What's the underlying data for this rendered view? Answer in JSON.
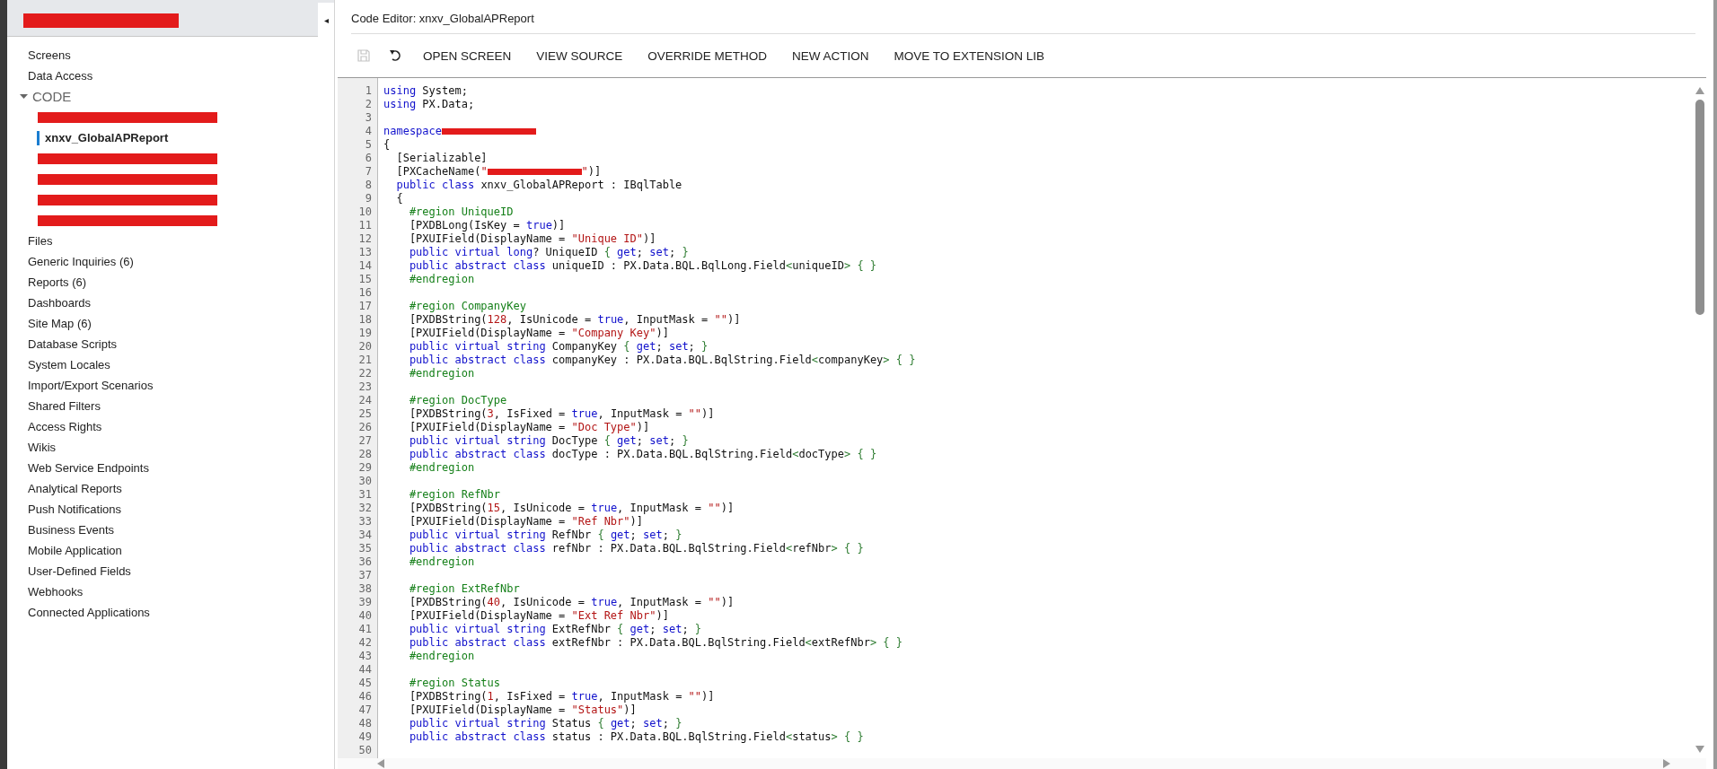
{
  "sidebar": {
    "header": {
      "redacted": true
    },
    "collapse_button": "◂",
    "items": [
      {
        "label": "Screens"
      },
      {
        "label": "Data Access"
      },
      {
        "label": "CODE",
        "expanded": true,
        "children": [
          {
            "redacted": true,
            "selected": false
          },
          {
            "label": "xnxv_GlobalAPReport",
            "selected": true
          },
          {
            "redacted": true,
            "selected": false
          },
          {
            "redacted": true,
            "selected": false
          },
          {
            "redacted": true,
            "selected": false
          },
          {
            "redacted": true,
            "selected": false
          }
        ]
      },
      {
        "label": "Files"
      },
      {
        "label": "Generic Inquiries (6)"
      },
      {
        "label": "Reports (6)"
      },
      {
        "label": "Dashboards"
      },
      {
        "label": "Site Map (6)"
      },
      {
        "label": "Database Scripts"
      },
      {
        "label": "System Locales"
      },
      {
        "label": "Import/Export Scenarios"
      },
      {
        "label": "Shared Filters"
      },
      {
        "label": "Access Rights"
      },
      {
        "label": "Wikis"
      },
      {
        "label": "Web Service Endpoints"
      },
      {
        "label": "Analytical Reports"
      },
      {
        "label": "Push Notifications"
      },
      {
        "label": "Business Events"
      },
      {
        "label": "Mobile Application"
      },
      {
        "label": "User-Defined Fields"
      },
      {
        "label": "Webhooks"
      },
      {
        "label": "Connected Applications"
      }
    ]
  },
  "editor": {
    "title": "Code Editor: xnxv_GlobalAPReport",
    "toolbar": [
      {
        "kind": "save",
        "disabled": true
      },
      {
        "kind": "undo",
        "disabled": false
      },
      {
        "kind": "text",
        "label": "OPEN SCREEN"
      },
      {
        "kind": "text",
        "label": "VIEW SOURCE"
      },
      {
        "kind": "text",
        "label": "OVERRIDE METHOD"
      },
      {
        "kind": "text",
        "label": "NEW ACTION"
      },
      {
        "kind": "text",
        "label": "MOVE TO EXTENSION LIB"
      }
    ],
    "lines": [
      {
        "number": "1",
        "tokens": [
          {
            "kind": "kw",
            "text": "using"
          },
          {
            "kind": "plain",
            "text": " System;"
          }
        ]
      },
      {
        "number": "2",
        "tokens": [
          {
            "kind": "kw",
            "text": "using"
          },
          {
            "kind": "plain",
            "text": " PX.Data;"
          }
        ]
      },
      {
        "number": "3"
      },
      {
        "number": "4",
        "tokens": [
          {
            "kind": "kw",
            "text": "namespace"
          },
          {
            "kind": "redaction"
          }
        ]
      },
      {
        "number": "5",
        "tokens": [
          {
            "kind": "plain",
            "text": "{"
          }
        ]
      },
      {
        "number": "6",
        "tokens": [
          {
            "kind": "plain",
            "text": "  [Serializable]"
          }
        ]
      },
      {
        "number": "7",
        "tokens": [
          {
            "kind": "plain",
            "text": "  [PXCacheName("
          },
          {
            "kind": "str",
            "text": "\""
          },
          {
            "kind": "redaction"
          },
          {
            "kind": "str",
            "text": "\""
          },
          {
            "kind": "plain",
            "text": ")]"
          }
        ]
      },
      {
        "number": "8",
        "tokens": [
          {
            "kind": "kw",
            "text": "  public class"
          },
          {
            "kind": "plain",
            "text": " xnxv_GlobalAPReport : IBqlTable"
          }
        ]
      },
      {
        "number": "9",
        "tokens": [
          {
            "kind": "plain",
            "text": "  {"
          }
        ]
      },
      {
        "number": "10",
        "tokens": [
          {
            "kind": "dir",
            "text": "    #region UniqueID"
          }
        ]
      },
      {
        "number": "11",
        "tokens": [
          {
            "kind": "plain",
            "text": "    [PXDBLong(IsKey = "
          },
          {
            "kind": "kw",
            "text": "true"
          },
          {
            "kind": "plain",
            "text": ")]"
          }
        ]
      },
      {
        "number": "12",
        "tokens": [
          {
            "kind": "plain",
            "text": "    [PXUIField(DisplayName = "
          },
          {
            "kind": "str",
            "text": "\"Unique ID\""
          },
          {
            "kind": "plain",
            "text": ")]"
          }
        ]
      },
      {
        "number": "13",
        "tokens": [
          {
            "kind": "kw",
            "text": "    public virtual long"
          },
          {
            "kind": "plain",
            "text": "? UniqueID "
          },
          {
            "kind": "punct",
            "text": "{"
          },
          {
            "kind": "kw",
            "text": " get"
          },
          {
            "kind": "plain",
            "text": ";"
          },
          {
            "kind": "kw",
            "text": " set"
          },
          {
            "kind": "plain",
            "text": ";"
          },
          {
            "kind": "punct",
            "text": " }"
          }
        ]
      },
      {
        "number": "14",
        "tokens": [
          {
            "kind": "kw",
            "text": "    public abstract class"
          },
          {
            "kind": "plain",
            "text": " uniqueID : PX.Data.BQL.BqlLong.Field"
          },
          {
            "kind": "punct",
            "text": "<"
          },
          {
            "kind": "plain",
            "text": "uniqueID"
          },
          {
            "kind": "punct",
            "text": "> { }"
          }
        ]
      },
      {
        "number": "15",
        "tokens": [
          {
            "kind": "dir",
            "text": "    #endregion"
          }
        ]
      },
      {
        "number": "16"
      },
      {
        "number": "17",
        "tokens": [
          {
            "kind": "dir",
            "text": "    #region CompanyKey"
          }
        ]
      },
      {
        "number": "18",
        "tokens": [
          {
            "kind": "plain",
            "text": "    [PXDBString("
          },
          {
            "kind": "num",
            "text": "128"
          },
          {
            "kind": "plain",
            "text": ", IsUnicode = "
          },
          {
            "kind": "kw",
            "text": "true"
          },
          {
            "kind": "plain",
            "text": ", InputMask = "
          },
          {
            "kind": "str",
            "text": "\"\""
          },
          {
            "kind": "plain",
            "text": ")]"
          }
        ]
      },
      {
        "number": "19",
        "tokens": [
          {
            "kind": "plain",
            "text": "    [PXUIField(DisplayName = "
          },
          {
            "kind": "str",
            "text": "\"Company Key\""
          },
          {
            "kind": "plain",
            "text": ")]"
          }
        ]
      },
      {
        "number": "20",
        "tokens": [
          {
            "kind": "kw",
            "text": "    public virtual string"
          },
          {
            "kind": "plain",
            "text": " CompanyKey "
          },
          {
            "kind": "punct",
            "text": "{"
          },
          {
            "kind": "kw",
            "text": " get"
          },
          {
            "kind": "plain",
            "text": ";"
          },
          {
            "kind": "kw",
            "text": " set"
          },
          {
            "kind": "plain",
            "text": ";"
          },
          {
            "kind": "punct",
            "text": " }"
          }
        ]
      },
      {
        "number": "21",
        "tokens": [
          {
            "kind": "kw",
            "text": "    public abstract class"
          },
          {
            "kind": "plain",
            "text": " companyKey : PX.Data.BQL.BqlString.Field"
          },
          {
            "kind": "punct",
            "text": "<"
          },
          {
            "kind": "plain",
            "text": "companyKey"
          },
          {
            "kind": "punct",
            "text": "> { }"
          }
        ]
      },
      {
        "number": "22",
        "tokens": [
          {
            "kind": "dir",
            "text": "    #endregion"
          }
        ]
      },
      {
        "number": "23"
      },
      {
        "number": "24",
        "tokens": [
          {
            "kind": "dir",
            "text": "    #region DocType"
          }
        ]
      },
      {
        "number": "25",
        "tokens": [
          {
            "kind": "plain",
            "text": "    [PXDBString("
          },
          {
            "kind": "num",
            "text": "3"
          },
          {
            "kind": "plain",
            "text": ", IsFixed = "
          },
          {
            "kind": "kw",
            "text": "true"
          },
          {
            "kind": "plain",
            "text": ", InputMask = "
          },
          {
            "kind": "str",
            "text": "\"\""
          },
          {
            "kind": "plain",
            "text": ")]"
          }
        ]
      },
      {
        "number": "26",
        "tokens": [
          {
            "kind": "plain",
            "text": "    [PXUIField(DisplayName = "
          },
          {
            "kind": "str",
            "text": "\"Doc Type\""
          },
          {
            "kind": "plain",
            "text": ")]"
          }
        ]
      },
      {
        "number": "27",
        "tokens": [
          {
            "kind": "kw",
            "text": "    public virtual string"
          },
          {
            "kind": "plain",
            "text": " DocType "
          },
          {
            "kind": "punct",
            "text": "{"
          },
          {
            "kind": "kw",
            "text": " get"
          },
          {
            "kind": "plain",
            "text": ";"
          },
          {
            "kind": "kw",
            "text": " set"
          },
          {
            "kind": "plain",
            "text": ";"
          },
          {
            "kind": "punct",
            "text": " }"
          }
        ]
      },
      {
        "number": "28",
        "tokens": [
          {
            "kind": "kw",
            "text": "    public abstract class"
          },
          {
            "kind": "plain",
            "text": " docType : PX.Data.BQL.BqlString.Field"
          },
          {
            "kind": "punct",
            "text": "<"
          },
          {
            "kind": "plain",
            "text": "docType"
          },
          {
            "kind": "punct",
            "text": "> { }"
          }
        ]
      },
      {
        "number": "29",
        "tokens": [
          {
            "kind": "dir",
            "text": "    #endregion"
          }
        ]
      },
      {
        "number": "30"
      },
      {
        "number": "31",
        "tokens": [
          {
            "kind": "dir",
            "text": "    #region RefNbr"
          }
        ]
      },
      {
        "number": "32",
        "tokens": [
          {
            "kind": "plain",
            "text": "    [PXDBString("
          },
          {
            "kind": "num",
            "text": "15"
          },
          {
            "kind": "plain",
            "text": ", IsUnicode = "
          },
          {
            "kind": "kw",
            "text": "true"
          },
          {
            "kind": "plain",
            "text": ", InputMask = "
          },
          {
            "kind": "str",
            "text": "\"\""
          },
          {
            "kind": "plain",
            "text": ")]"
          }
        ]
      },
      {
        "number": "33",
        "tokens": [
          {
            "kind": "plain",
            "text": "    [PXUIField(DisplayName = "
          },
          {
            "kind": "str",
            "text": "\"Ref Nbr\""
          },
          {
            "kind": "plain",
            "text": ")]"
          }
        ]
      },
      {
        "number": "34",
        "tokens": [
          {
            "kind": "kw",
            "text": "    public virtual string"
          },
          {
            "kind": "plain",
            "text": " RefNbr "
          },
          {
            "kind": "punct",
            "text": "{"
          },
          {
            "kind": "kw",
            "text": " get"
          },
          {
            "kind": "plain",
            "text": ";"
          },
          {
            "kind": "kw",
            "text": " set"
          },
          {
            "kind": "plain",
            "text": ";"
          },
          {
            "kind": "punct",
            "text": " }"
          }
        ]
      },
      {
        "number": "35",
        "tokens": [
          {
            "kind": "kw",
            "text": "    public abstract class"
          },
          {
            "kind": "plain",
            "text": " refNbr : PX.Data.BQL.BqlString.Field"
          },
          {
            "kind": "punct",
            "text": "<"
          },
          {
            "kind": "plain",
            "text": "refNbr"
          },
          {
            "kind": "punct",
            "text": "> { }"
          }
        ]
      },
      {
        "number": "36",
        "tokens": [
          {
            "kind": "dir",
            "text": "    #endregion"
          }
        ]
      },
      {
        "number": "37"
      },
      {
        "number": "38",
        "tokens": [
          {
            "kind": "dir",
            "text": "    #region ExtRefNbr"
          }
        ]
      },
      {
        "number": "39",
        "tokens": [
          {
            "kind": "plain",
            "text": "    [PXDBString("
          },
          {
            "kind": "num",
            "text": "40"
          },
          {
            "kind": "plain",
            "text": ", IsUnicode = "
          },
          {
            "kind": "kw",
            "text": "true"
          },
          {
            "kind": "plain",
            "text": ", InputMask = "
          },
          {
            "kind": "str",
            "text": "\"\""
          },
          {
            "kind": "plain",
            "text": ")]"
          }
        ]
      },
      {
        "number": "40",
        "tokens": [
          {
            "kind": "plain",
            "text": "    [PXUIField(DisplayName = "
          },
          {
            "kind": "str",
            "text": "\"Ext Ref Nbr\""
          },
          {
            "kind": "plain",
            "text": ")]"
          }
        ]
      },
      {
        "number": "41",
        "tokens": [
          {
            "kind": "kw",
            "text": "    public virtual string"
          },
          {
            "kind": "plain",
            "text": " ExtRefNbr "
          },
          {
            "kind": "punct",
            "text": "{"
          },
          {
            "kind": "kw",
            "text": " get"
          },
          {
            "kind": "plain",
            "text": ";"
          },
          {
            "kind": "kw",
            "text": " set"
          },
          {
            "kind": "plain",
            "text": ";"
          },
          {
            "kind": "punct",
            "text": " }"
          }
        ]
      },
      {
        "number": "42",
        "tokens": [
          {
            "kind": "kw",
            "text": "    public abstract class"
          },
          {
            "kind": "plain",
            "text": " extRefNbr : PX.Data.BQL.BqlString.Field"
          },
          {
            "kind": "punct",
            "text": "<"
          },
          {
            "kind": "plain",
            "text": "extRefNbr"
          },
          {
            "kind": "punct",
            "text": "> { }"
          }
        ]
      },
      {
        "number": "43",
        "tokens": [
          {
            "kind": "dir",
            "text": "    #endregion"
          }
        ]
      },
      {
        "number": "44"
      },
      {
        "number": "45",
        "tokens": [
          {
            "kind": "dir",
            "text": "    #region Status"
          }
        ]
      },
      {
        "number": "46",
        "tokens": [
          {
            "kind": "plain",
            "text": "    [PXDBString("
          },
          {
            "kind": "num",
            "text": "1"
          },
          {
            "kind": "plain",
            "text": ", IsFixed = "
          },
          {
            "kind": "kw",
            "text": "true"
          },
          {
            "kind": "plain",
            "text": ", InputMask = "
          },
          {
            "kind": "str",
            "text": "\"\""
          },
          {
            "kind": "plain",
            "text": ")]"
          }
        ]
      },
      {
        "number": "47",
        "tokens": [
          {
            "kind": "plain",
            "text": "    [PXUIField(DisplayName = "
          },
          {
            "kind": "str",
            "text": "\"Status\""
          },
          {
            "kind": "plain",
            "text": ")]"
          }
        ]
      },
      {
        "number": "48",
        "tokens": [
          {
            "kind": "kw",
            "text": "    public virtual string"
          },
          {
            "kind": "plain",
            "text": " Status "
          },
          {
            "kind": "punct",
            "text": "{"
          },
          {
            "kind": "kw",
            "text": " get"
          },
          {
            "kind": "plain",
            "text": ";"
          },
          {
            "kind": "kw",
            "text": " set"
          },
          {
            "kind": "plain",
            "text": ";"
          },
          {
            "kind": "punct",
            "text": " }"
          }
        ]
      },
      {
        "number": "49",
        "tokens": [
          {
            "kind": "kw",
            "text": "    public abstract class"
          },
          {
            "kind": "plain",
            "text": " status : PX.Data.BQL.BqlString.Field"
          },
          {
            "kind": "punct",
            "text": "<"
          },
          {
            "kind": "plain",
            "text": "status"
          },
          {
            "kind": "punct",
            "text": "> { }"
          }
        ]
      },
      {
        "number": "50"
      }
    ]
  }
}
